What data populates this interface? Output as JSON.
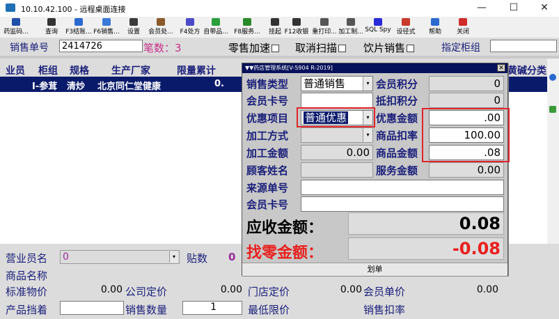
{
  "window": {
    "title": "10.10.42.100 - 远程桌面连接",
    "minimize": "—",
    "maximize": "☐",
    "close": "✕"
  },
  "toolbar": [
    {
      "label": "药监码...",
      "color": "#1f4fa8"
    },
    {
      "label": "查询",
      "color": "#333333"
    },
    {
      "label": "F3结账...",
      "color": "#2a6ad0"
    },
    {
      "label": "F6销售...",
      "color": "#3a7ad8"
    },
    {
      "label": "设置",
      "color": "#3a3a3a"
    },
    {
      "label": "会员处...",
      "color": "#8a5a2a"
    },
    {
      "label": "F4处方",
      "color": "#4a4ac8"
    },
    {
      "label": "自带品...",
      "color": "#2aa03a"
    },
    {
      "label": "F8服务...",
      "color": "#2a8a2a"
    },
    {
      "label": "挂起",
      "color": "#333333"
    },
    {
      "label": "F12收银",
      "color": "#333333"
    },
    {
      "label": "重打印...",
      "color": "#555555"
    },
    {
      "label": "加工制...",
      "color": "#555555"
    },
    {
      "label": "SQL Spy",
      "color": "#2a2ad8"
    },
    {
      "label": "设径式",
      "color": "#c83a2a"
    },
    {
      "label": "帮助",
      "color": "#2a6ad0"
    },
    {
      "label": "关闭",
      "color": "#d02a2a"
    }
  ],
  "header": {
    "order_label": "销售单号",
    "order_value": "2414726",
    "count_text": "笔数：3",
    "retail_speedup": "零售加速",
    "cancel_scan": "取消扫描",
    "drink_sale": "饮片销售",
    "cabinet_label": "指定柜组"
  },
  "grid": {
    "columns": [
      "业员",
      "柜组",
      "规格",
      "生产厂家",
      "限量累计",
      "黄碱分类"
    ],
    "rows": [
      {
        "clerk": "",
        "cabinet": "I-参茸",
        "spec": "清炒",
        "maker": "北京同仁堂健康",
        "limit": "0."
      }
    ]
  },
  "bottom": {
    "clerk_label": "营业员名",
    "clerk_value": "0",
    "stickers_label": "贴数",
    "stickers_value": "0",
    "product_label": "商品名称",
    "std_price_label": "标准物价",
    "std_price_value": "0.00",
    "co_price_label": "公司定价",
    "co_price_value": "0.00",
    "store_price_label": "门店定价",
    "store_price_value": "0.00",
    "member_price_label": "会员单价",
    "member_price_value": "0.00",
    "row4_a": "产品挡着",
    "row4_b": "销售数量",
    "row4_c": "最低限价",
    "row4_d": "销售扣率",
    "qty_value": "1"
  },
  "dialog": {
    "title": "▼▼药店管理系统[V-5904 R-2019]",
    "close": "✕",
    "sale_type_label": "销售类型",
    "sale_type_value": "普通销售",
    "member_points_label": "会员积分",
    "member_points_value": "0",
    "member_card_label": "会员卡号",
    "deduct_points_label": "抵扣积分",
    "deduct_points_value": "0",
    "discount_item_label": "优惠项目",
    "discount_item_value": "普通优惠",
    "discount_amount_label": "优惠金额",
    "discount_amount_value": ".00",
    "process_method_label": "加工方式",
    "product_rate_label": "商品扣率",
    "product_rate_value": "100.00",
    "process_amount_label": "加工金额",
    "process_amount_value": "0.00",
    "product_amount_label": "商品金额",
    "product_amount_value": ".08",
    "customer_name_label": "顾客姓名",
    "service_amount_label": "服务金额",
    "service_amount_value": "0.00",
    "source_no_label": "来源单号",
    "member_card2_label": "会员卡号",
    "receivable_label": "应收金额：",
    "receivable_value": "0.08",
    "change_label": "找零金额：",
    "change_value": "-0.08",
    "footer": "划单"
  }
}
